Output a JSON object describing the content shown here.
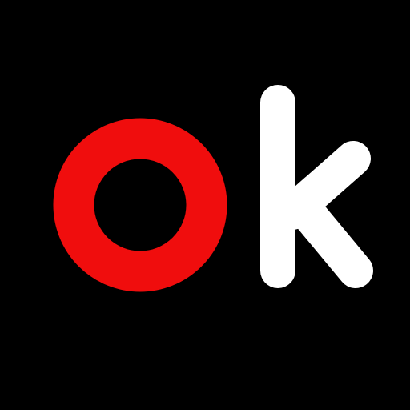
{
  "logo": {
    "text": "ok",
    "letters": [
      {
        "char": "o",
        "color": "#F00D0D"
      },
      {
        "char": "k",
        "color": "#FFFFFF"
      }
    ]
  },
  "colors": {
    "background": "#000000",
    "accent": "#F00D0D",
    "foreground": "#FFFFFF"
  }
}
